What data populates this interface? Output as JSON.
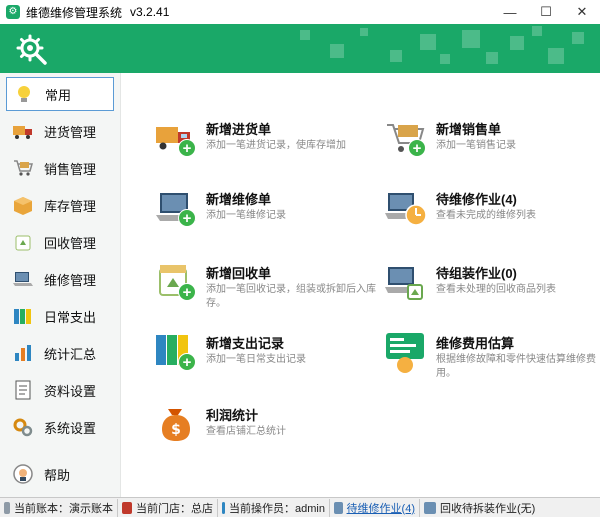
{
  "window": {
    "title": "维德维修管理系统",
    "version": "v3.2.41",
    "minimize": "—",
    "maximize": "☐",
    "close": "✕"
  },
  "sidebar": {
    "items": [
      {
        "label": "常用",
        "icon": "lightbulb-icon"
      },
      {
        "label": "进货管理",
        "icon": "truck-icon"
      },
      {
        "label": "销售管理",
        "icon": "cart-icon"
      },
      {
        "label": "库存管理",
        "icon": "box-icon"
      },
      {
        "label": "回收管理",
        "icon": "recycle-icon"
      },
      {
        "label": "维修管理",
        "icon": "laptop-tools-icon"
      },
      {
        "label": "日常支出",
        "icon": "binders-icon"
      },
      {
        "label": "统计汇总",
        "icon": "chart-icon"
      },
      {
        "label": "资料设置",
        "icon": "document-icon"
      },
      {
        "label": "系统设置",
        "icon": "gears-icon"
      },
      {
        "label": "帮助",
        "icon": "help-icon"
      }
    ]
  },
  "tiles": [
    {
      "title": "新增进货单",
      "desc": "添加一笔进货记录，使库存增加",
      "icon": "truck-add-icon"
    },
    {
      "title": "新增销售单",
      "desc": "添加一笔销售记录",
      "icon": "cart-add-icon"
    },
    {
      "title": "新增维修单",
      "desc": "添加一笔维修记录",
      "icon": "laptop-add-icon"
    },
    {
      "title": "待维修作业(4)",
      "desc": "查看未完成的维修列表",
      "icon": "laptop-clock-icon"
    },
    {
      "title": "新增回收单",
      "desc": "添加一笔回收记录，组装或拆卸后入库存。",
      "icon": "recycle-add-icon"
    },
    {
      "title": "待组装作业(0)",
      "desc": "查看未处理的回收商品列表",
      "icon": "laptop-recycle-icon"
    },
    {
      "title": "新增支出记录",
      "desc": "添加一笔日常支出记录",
      "icon": "binders-add-icon"
    },
    {
      "title": "维修费用估算",
      "desc": "根据维修故障和零件快速估算维修费用。",
      "icon": "estimate-icon"
    },
    {
      "title": "利润统计",
      "desc": "查看店铺汇总统计",
      "icon": "money-bag-icon"
    }
  ],
  "statusbar": {
    "account": "当前账本：演示账本",
    "store": "当前门店：总店",
    "operator": "当前操作员：admin",
    "pending_repair": "待维修作业(4)",
    "pending_recycle": "回收待拆装作业(无)"
  },
  "colors": {
    "brand": "#1aa868",
    "plus": "#3bb44a",
    "link": "#1a5fb4"
  }
}
